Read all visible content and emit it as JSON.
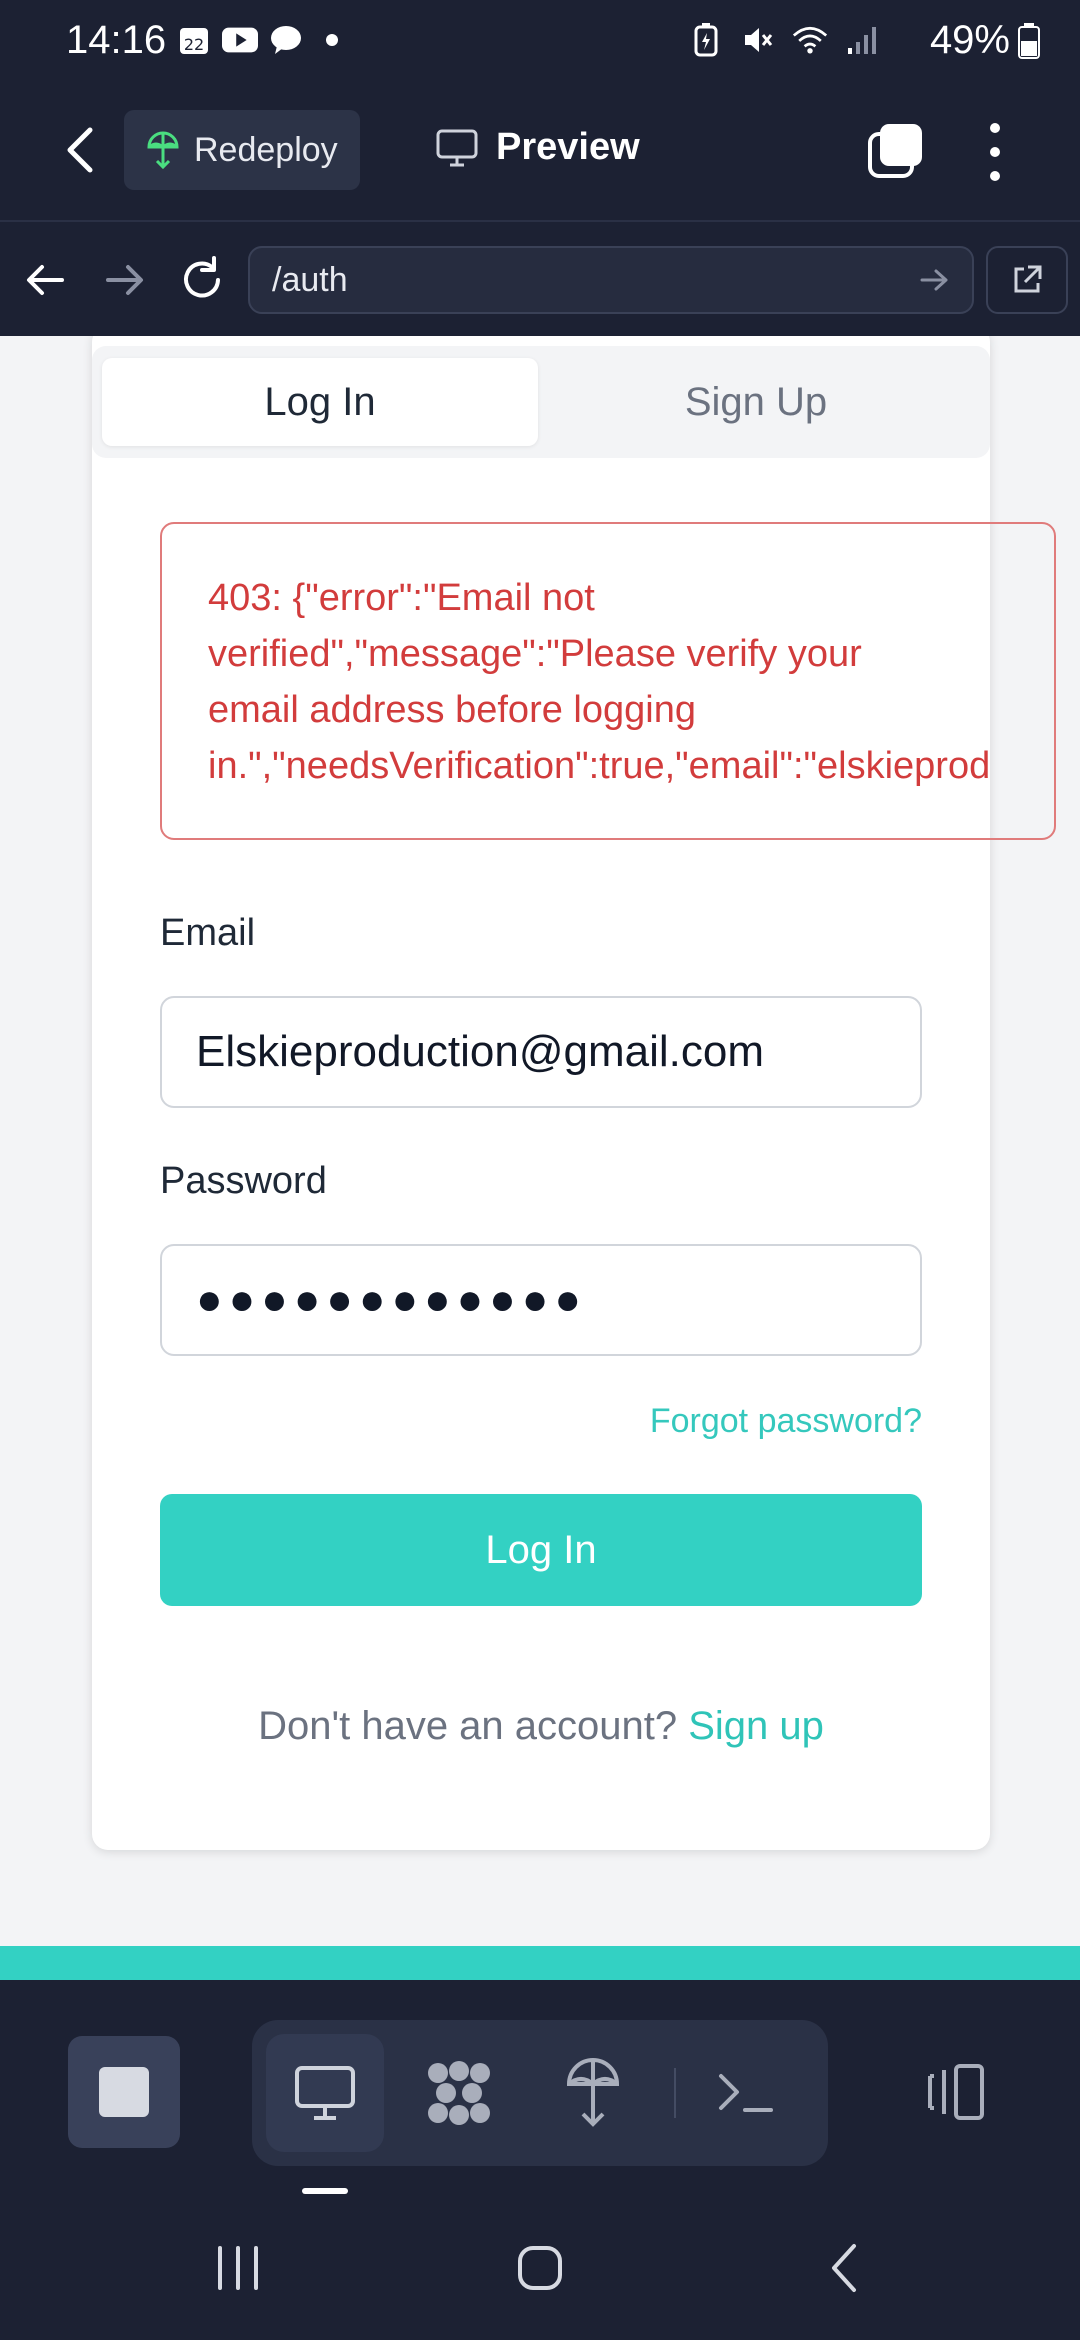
{
  "status_bar": {
    "time": "14:16",
    "calendar_day": "22",
    "battery": "49%",
    "icons_left": [
      "calendar-icon",
      "youtube-icon",
      "chat-icon",
      "dot-icon"
    ],
    "icons_right": [
      "battery-saver-icon",
      "mute-icon",
      "wifi-icon",
      "signal-icon",
      "battery-icon"
    ]
  },
  "toolbar": {
    "redeploy_label": "Redeploy",
    "preview_label": "Preview"
  },
  "url_bar": {
    "url": "/auth"
  },
  "auth": {
    "tabs": [
      {
        "label": "Log In",
        "active": true
      },
      {
        "label": "Sign Up",
        "active": false
      }
    ],
    "error_lines": [
      "403: {\"error\":\"Email not",
      "verified\",\"message\":\"Please verify your",
      "email address before logging",
      "in.\",\"needsVerification\":true,\"email\":\"elskieprod"
    ],
    "email_label": "Email",
    "email_value": "Elskieproduction@gmail.com",
    "password_label": "Password",
    "password_value": "●●●●●●●●●●●●",
    "forgot_label": "Forgot password?",
    "login_button": "Log In",
    "no_account_text": "Don't have an account? ",
    "signup_link": "Sign up"
  },
  "colors": {
    "accent": "#33d1c3",
    "error": "#d23c3c",
    "chrome_bg": "#1c2133"
  }
}
